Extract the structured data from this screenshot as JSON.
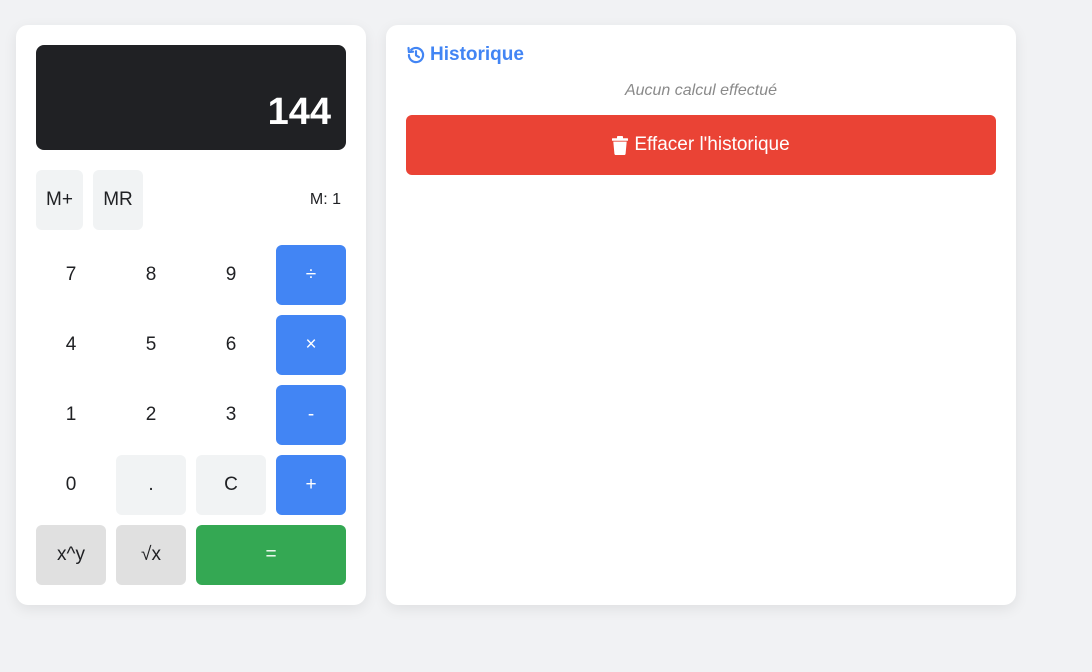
{
  "display": {
    "value": "144"
  },
  "memory": {
    "add_label": "M+",
    "recall_label": "MR",
    "indicator": "M: 1"
  },
  "keys": {
    "seven": "7",
    "eight": "8",
    "nine": "9",
    "divide": "÷",
    "four": "4",
    "five": "5",
    "six": "6",
    "multiply": "×",
    "one": "1",
    "two": "2",
    "three": "3",
    "subtract": "-",
    "zero": "0",
    "decimal": ".",
    "clear": "C",
    "add": "+",
    "power": "x^y",
    "sqrt": "√x",
    "equals": "="
  },
  "history": {
    "title": "Historique",
    "title_icon": "history-icon",
    "empty_text": "Aucun calcul effectué",
    "clear_label": "Effacer l'historique",
    "clear_icon": "trash-icon"
  },
  "colors": {
    "operator": "#4285f4",
    "equals": "#34a853",
    "danger": "#ea4335",
    "display_bg": "#202124"
  }
}
